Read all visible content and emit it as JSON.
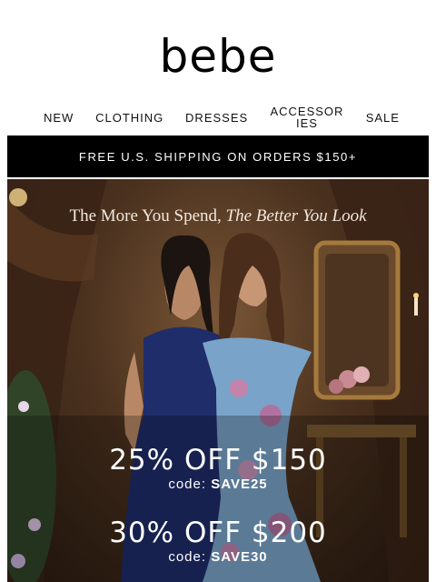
{
  "brand": {
    "logo": "bebe"
  },
  "nav": {
    "items": [
      {
        "label": "NEW"
      },
      {
        "label": "CLOTHING"
      },
      {
        "label": "DRESSES"
      },
      {
        "label": "ACCESSORIES"
      },
      {
        "label": "SALE"
      }
    ]
  },
  "promo_bar": {
    "text": "FREE U.S. SHIPPING ON ORDERS $150+"
  },
  "hero": {
    "tagline_start": "The More You Spend,",
    "tagline_end": "The Better You Look",
    "offers": [
      {
        "headline": "25% OFF $150",
        "code_prefix": "code:",
        "code": "SAVE25"
      },
      {
        "headline": "30% OFF $200",
        "code_prefix": "code:",
        "code": "SAVE30"
      }
    ]
  },
  "colors": {
    "bar": "#000000",
    "hero_bg": "#4b321f",
    "navy_outfit": "#1f2d6b",
    "floral_dress": "#7aa3c9"
  }
}
